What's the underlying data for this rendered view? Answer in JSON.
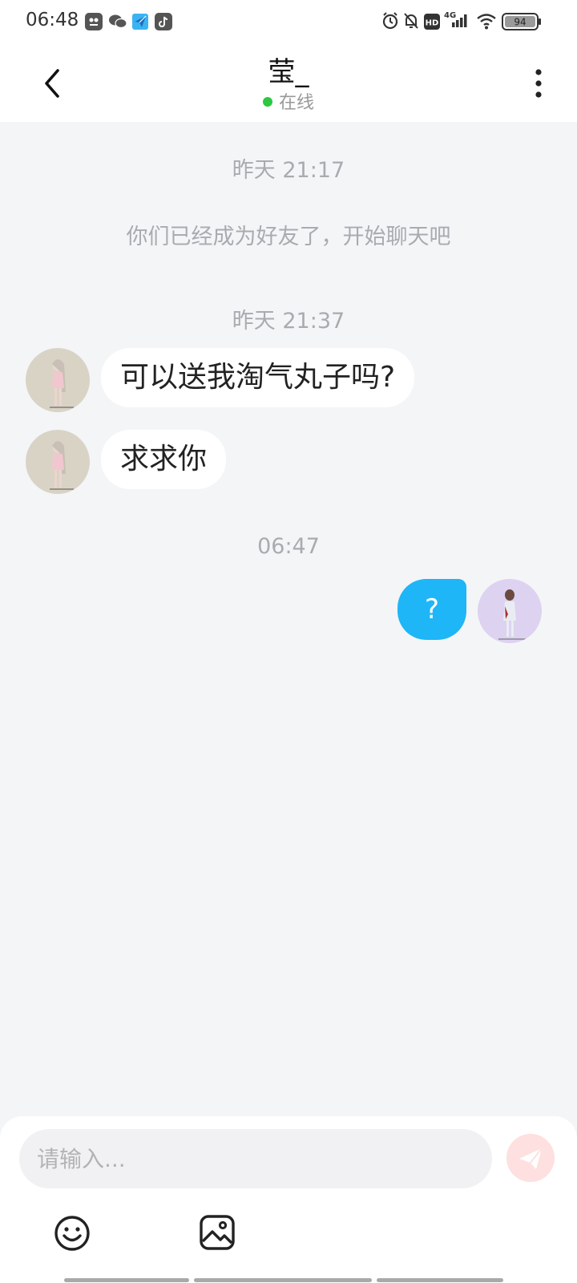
{
  "status_bar": {
    "time": "06:48",
    "apps": [
      "scan-app-icon",
      "wechat-icon",
      "send-app-icon",
      "tiktok-icon"
    ],
    "hd": "HD",
    "network": "4G",
    "battery": "94"
  },
  "header": {
    "contact_name": "莹_",
    "presence": "在线"
  },
  "messages": [
    {
      "kind": "timestamp",
      "text": "昨天 21:17"
    },
    {
      "kind": "system",
      "text": "你们已经成为好友了，开始聊天吧"
    },
    {
      "kind": "timestamp",
      "text": "昨天 21:37"
    },
    {
      "kind": "incoming",
      "text": "可以送我淘气丸子吗?"
    },
    {
      "kind": "incoming",
      "text": "求求你"
    },
    {
      "kind": "timestamp",
      "text": "06:47"
    },
    {
      "kind": "outgoing",
      "text": "?"
    }
  ],
  "composer": {
    "placeholder": "请输入..."
  },
  "colors": {
    "outgoing_bubble": "#1eb6f7",
    "online_dot": "#2bc840",
    "send_button": "#fde0df",
    "background": "#f4f5f7"
  }
}
